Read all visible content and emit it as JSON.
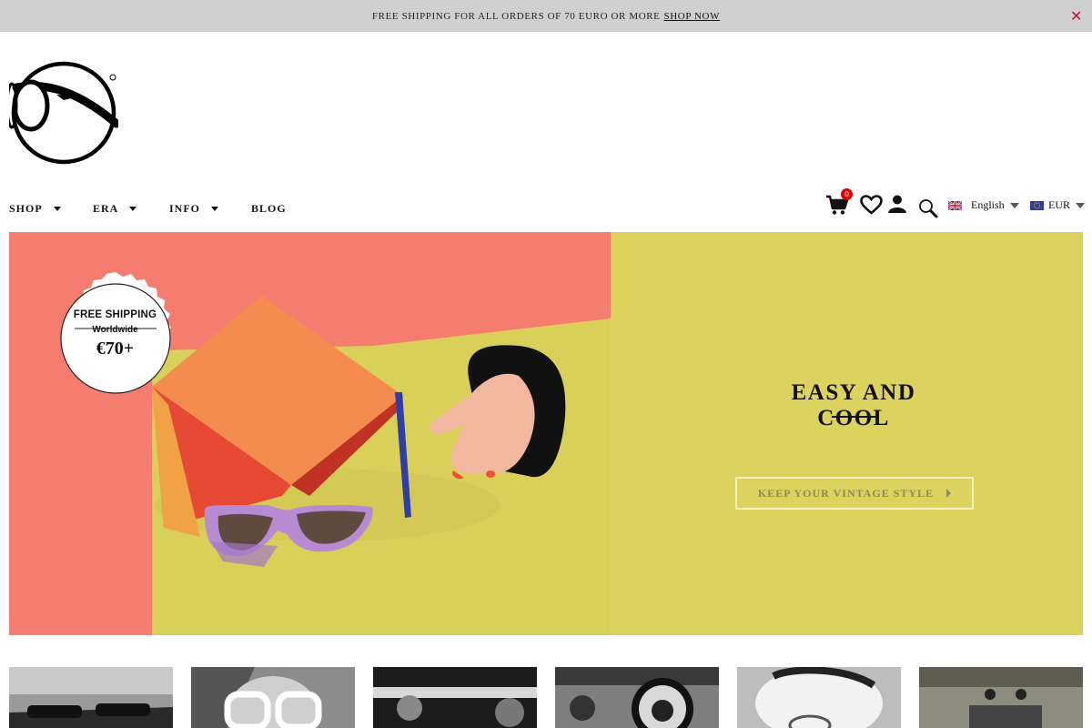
{
  "announcement": {
    "text": "FREE SHIPPING FOR ALL ORDERS OF 70 EURO OR MORE",
    "link": "SHOP NOW",
    "close": "✕"
  },
  "nav": {
    "items": [
      {
        "label": "SHOP",
        "has_dropdown": true
      },
      {
        "label": "ERA",
        "has_dropdown": true
      },
      {
        "label": "INFO",
        "has_dropdown": true
      },
      {
        "label": "BLOG",
        "has_dropdown": false
      }
    ]
  },
  "tools": {
    "cart_count": "0",
    "icons": [
      "cart-icon",
      "heart-icon",
      "user-icon",
      "search-icon"
    ]
  },
  "language": {
    "selected": "English"
  },
  "currency": {
    "selected": "EUR"
  },
  "hero": {
    "stamp_line1": "FREE SHIPPING",
    "stamp_line2": "Worldwide",
    "stamp_price": "€70+",
    "title": "EASY AND COOL",
    "button": "KEEP YOUR VINTAGE STYLE",
    "colors": {
      "coral": "#f47d6f",
      "yellow": "#dcd25e",
      "button_border": "#f3efc2"
    }
  },
  "thumbnails": [
    {
      "name": "thumb-1"
    },
    {
      "name": "thumb-2"
    },
    {
      "name": "thumb-3"
    },
    {
      "name": "thumb-4"
    },
    {
      "name": "thumb-5"
    },
    {
      "name": "thumb-6"
    }
  ]
}
